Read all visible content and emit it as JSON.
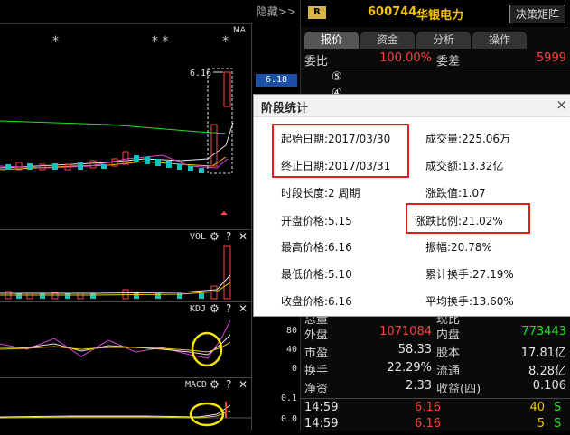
{
  "left": {
    "hide_label": "隐藏>>",
    "ma_label": "MA",
    "price_tag": "6.16",
    "current_price_box": "6.18",
    "star_marks": [
      "*",
      "* *",
      "*"
    ],
    "vol_title": "VOL",
    "kdj_title": "KDJ",
    "macd_title": "MACD",
    "kdj_axis": [
      "80",
      "40",
      "0"
    ],
    "macd_axis": [
      "0.1",
      "0.0"
    ]
  },
  "header": {
    "badge": "R",
    "code": "600744",
    "name": "华银电力",
    "decision_btn": "决策矩阵"
  },
  "tabs": [
    "报价",
    "资金",
    "分析",
    "操作"
  ],
  "quote": {
    "weibi_label": "委比",
    "weibi_value": "100.00%",
    "weicha_label": "委差",
    "weicha_value": "5999",
    "level5": "⑤",
    "level4": "④",
    "total_label": "总量",
    "now_label": "现比",
    "rows": [
      {
        "l1": "外盘",
        "v1": "1071084",
        "l2": "内盘",
        "v2": "773443"
      },
      {
        "l1": "市盈",
        "v1": "58.33",
        "l2": "股本",
        "v2": "17.81亿"
      },
      {
        "l1": "换手",
        "v1": "22.29%",
        "l2": "流通",
        "v2": "8.28亿"
      },
      {
        "l1": "净资",
        "v1": "2.33",
        "l2": "收益(四)",
        "v2": "0.106"
      }
    ],
    "ticks": [
      {
        "time": "14:59",
        "price": "6.16",
        "vol": "40",
        "side": "S"
      },
      {
        "time": "14:59",
        "price": "6.16",
        "vol": "5",
        "side": "S"
      }
    ]
  },
  "dialog": {
    "title": "阶段统计",
    "close": "×",
    "start_date": "起始日期:2017/03/30",
    "end_date": "终止日期:2017/03/31",
    "period_len": "时段长度:2 周期",
    "open_price": "开盘价格:5.15",
    "high_price": "最高价格:6.16",
    "low_price": "最低价格:5.10",
    "close_price": "收盘价格:6.16",
    "volume": "成交量:225.06万",
    "amount": "成交额:13.32亿",
    "change": "涨跌值:1.07",
    "change_pct": "涨跌比例:21.02%",
    "amplitude": "振幅:20.78%",
    "cum_turnover": "累计换手:27.19%",
    "avg_turnover": "平均换手:13.60%"
  }
}
